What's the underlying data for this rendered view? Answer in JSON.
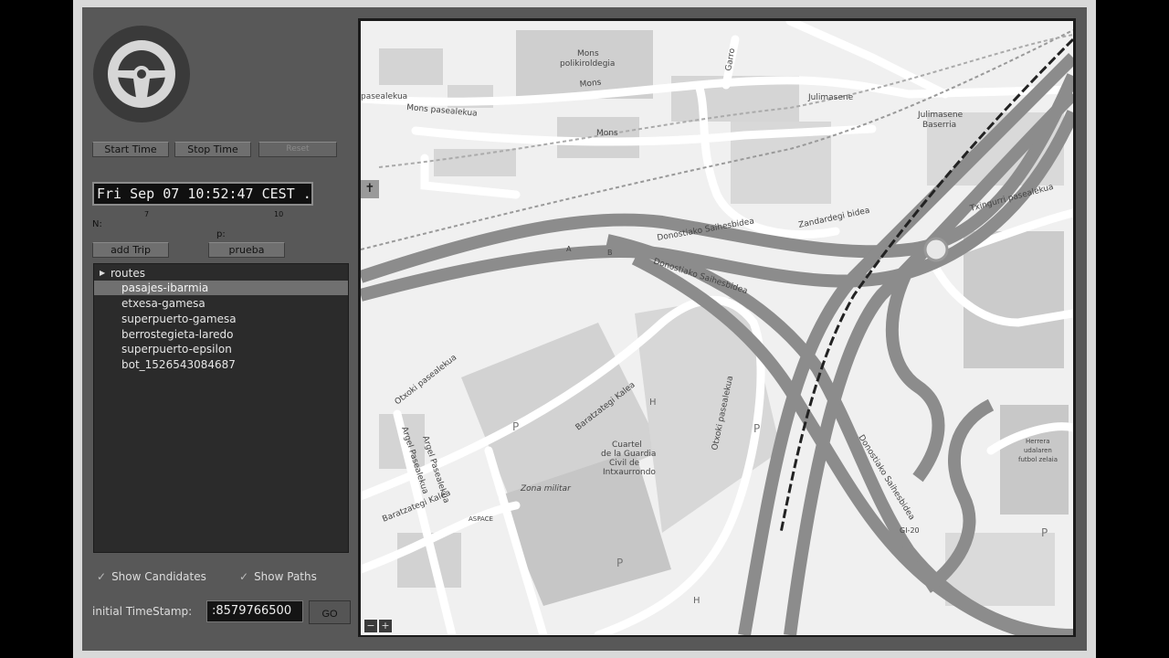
{
  "controls": {
    "start_label": "Start Time",
    "stop_label": "Stop Time",
    "reset_label": "Reset",
    "datetime": "Fri Sep 07 10:52:47 CEST ...",
    "slider_n_label": "N:",
    "slider_n_ticks": [
      "7",
      "10"
    ],
    "slider_p_label": "p:",
    "add_trip_label": "add Trip",
    "prueba_label": "prueba"
  },
  "routes": {
    "root_label": "routes",
    "items": [
      {
        "label": "pasajes-ibarmia",
        "selected": true
      },
      {
        "label": "etxesa-gamesa",
        "selected": false
      },
      {
        "label": "superpuerto-gamesa",
        "selected": false
      },
      {
        "label": "berrostegieta-laredo",
        "selected": false
      },
      {
        "label": "superpuerto-epsilon",
        "selected": false
      },
      {
        "label": "bot_1526543084687",
        "selected": false
      }
    ]
  },
  "options": {
    "show_candidates_label": "Show Candidates",
    "show_candidates_checked": true,
    "show_paths_label": "Show Paths",
    "show_paths_checked": true
  },
  "timestamp": {
    "label": "initial TimeStamp:",
    "value": ":8579766500",
    "go_label": "GO"
  },
  "map": {
    "labels": {
      "mons_poli": "Mons",
      "mons_poli2": "polikiroldegia",
      "mons_pasealekua": "Mons pasealekua",
      "pasealekua_left": "pasealekua",
      "mons_street1": "Mons",
      "mons_street2": "Mons",
      "garro": "Garro",
      "julimasene": "Julimasene",
      "julimasene_baserria1": "Julimasene",
      "julimasene_baserria2": "Baserria",
      "zandardegi": "Zandardegi bidea",
      "txingurri": "Txingurri pasealekua",
      "donostiako1": "Donostiako Saihesbidea",
      "donostiako2": "Donostiako Saihesbidea",
      "donostiako3": "Donostiako Saihesbidea",
      "otxoki1": "Otxoki pasealekua",
      "otxoki2": "Otxoki pasealekua",
      "baratzategi1": "Baratzategi Kalea",
      "baratzategi2": "Baratzategi Kalea",
      "argel1": "Argel Pasealekua",
      "argel2": "Argel Pasealekua",
      "cuartel1": "Cuartel",
      "cuartel2": "de la Guardia",
      "cuartel3": "Civil de",
      "cuartel4": "Intxaurrondo",
      "zona_militar": "Zona militar",
      "aspace": "ASPACE",
      "herrera1": "Herrera",
      "herrera2": "udalaren",
      "herrera3": "futbol zelaia",
      "gi20": "GI-20",
      "ref_a": "A",
      "ref_b": "B",
      "parking": "P",
      "helipad": "H",
      "cemetery": "✝"
    },
    "zoom_in": "+",
    "zoom_out": "−"
  }
}
